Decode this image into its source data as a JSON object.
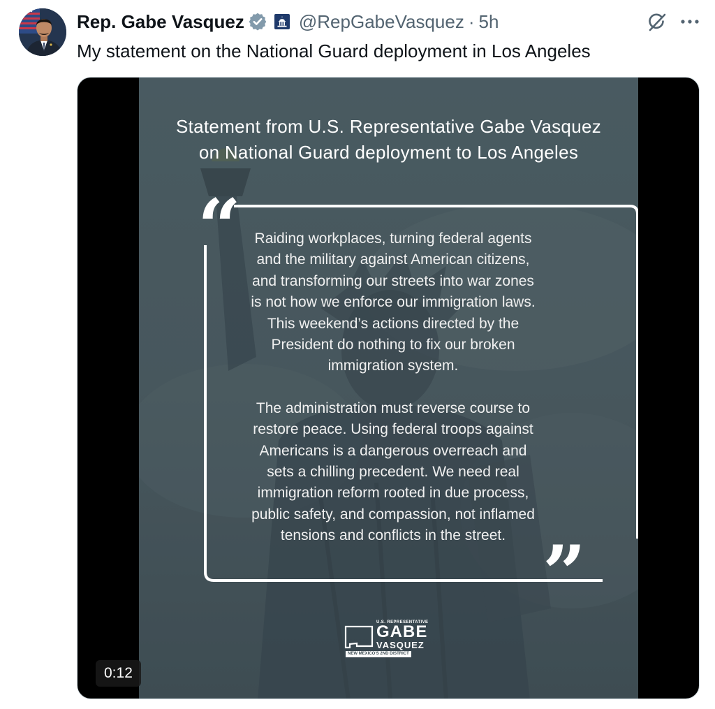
{
  "author": {
    "display_name": "Rep. Gabe Vasquez",
    "handle": "@RepGabeVasquez",
    "separator": "·",
    "time": "5h",
    "verified": true,
    "verified_color": "#829aab",
    "government_badge": "capitol-icon"
  },
  "tweet": {
    "text": "My statement on the National Guard deployment in Los Angeles"
  },
  "icons": {
    "grok": "grok-icon",
    "more": "more-icon"
  },
  "media": {
    "statement_title_line1": "Statement from U.S. Representative Gabe Vasquez",
    "statement_title_line2": "on National Guard deployment to Los Angeles",
    "quote_open": "“",
    "quote_close": "”",
    "paragraph1": [
      "Raiding workplaces, turning federal agents",
      "and the military against American citizens,",
      "and transforming our streets into war zones",
      "is not how we enforce our immigration laws.",
      "This weekend’s actions directed by the",
      "President do nothing to fix our broken",
      "immigration system."
    ],
    "paragraph2": [
      "The administration must reverse course to",
      "restore peace. Using federal troops against",
      "Americans is a dangerous overreach and",
      "sets a chilling precedent. We need real",
      "immigration reform rooted in due process,",
      "public safety, and compassion, not inflamed",
      "tensions and conflicts in the street."
    ],
    "logo": {
      "small_text": "U.S. REPRESENTATIVE",
      "name_first": "GABE",
      "name_last": "VASQUEZ",
      "district": "NEW MEXICO'S 2ND DISTRICT"
    },
    "timer": "0:12",
    "background_color": "#45565d"
  }
}
